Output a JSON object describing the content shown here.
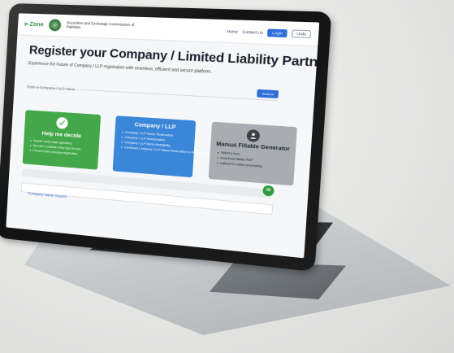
{
  "header": {
    "logo_text": "e-Zone",
    "logo_sub": "",
    "org_name": "Securities and Exchange Commission of Pakistan",
    "nav": [
      "Home",
      "Contact Us"
    ],
    "login_label": "Login",
    "lang_label": "Urdu"
  },
  "hero": {
    "title": "Register your Company / Limited Liability Partnership",
    "subtitle": "Experience the Future of Company / LLP registration with seamless, efficient and secure platform.",
    "search_placeholder": "Enter a Company / LLP name",
    "search_button": "Search"
  },
  "cards": [
    {
      "title": "Help me decide",
      "icon": "checklist-icon",
      "items": [
        "Answer some basic questions",
        "Receive a suitable entity type for you",
        "Proceed with company registration"
      ]
    },
    {
      "title": "Company / LLP",
      "icon": "",
      "items": [
        "Company / LLP Name Reservation",
        "Company / LLP Incorporation",
        "Company / LLP Name Availability",
        "Combined Company / LLP Name Reservation & Incorporation"
      ]
    },
    {
      "title": "Manual Fillable Generator",
      "icon": "person-icon",
      "items": [
        "Select a form",
        "Download fillable PDF",
        "Upload for online processing"
      ]
    }
  ],
  "bottom": {
    "name_search_label": "Company Name Search",
    "chat_icon": "chat-icon"
  },
  "colors": {
    "green": "#42a84a",
    "blue": "#3a86d9",
    "grey": "#a9adb2",
    "accent": "#2d6ed8"
  }
}
